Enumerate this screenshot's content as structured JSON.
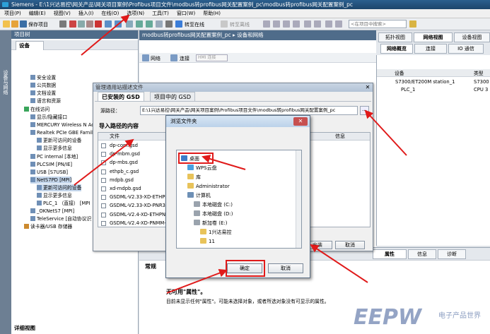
{
  "window": {
    "title": "Siemens - E:\\1兴达易控\\网关产品\\网关项目案例\\Profibus项目文件\\modbus转profibus网关配置案例_pc\\modbus转profibus网关配置案例_pc"
  },
  "menu": [
    "项目(P)",
    "编辑(E)",
    "视图(V)",
    "插入(I)",
    "在线(O)",
    "选项(N)",
    "工具(T)",
    "窗口(W)",
    "帮助(H)"
  ],
  "toolbar": {
    "save_label": "保存项目",
    "online_label": "转至在线",
    "offline_label": "转至离线",
    "search_placeholder": "<在项目中搜索>"
  },
  "side_strip": {
    "label": "设备与网络"
  },
  "project_tree": {
    "title": "项目树",
    "devices_tab": "设备",
    "items": [
      {
        "label": "安全设置",
        "indent": 1
      },
      {
        "label": "公共数据",
        "indent": 1
      },
      {
        "label": "文档设置",
        "indent": 1
      },
      {
        "label": "语言和资源",
        "indent": 1
      },
      {
        "label": "在线访问",
        "indent": 0
      },
      {
        "label": "显示/隐藏接口",
        "indent": 1
      },
      {
        "label": "MERCURY Wireless N Ad",
        "indent": 1
      },
      {
        "label": "Realtek PCIe GBE Family",
        "indent": 1
      },
      {
        "label": "更新可访问的设备",
        "indent": 2
      },
      {
        "label": "显示更多信息",
        "indent": 2
      },
      {
        "label": "PC internal [本地]",
        "indent": 1
      },
      {
        "label": "PLCSIM [PN/IE]",
        "indent": 1
      },
      {
        "label": "USB [S7USB]",
        "indent": 1
      },
      {
        "label": "NetS7PD [MPI]",
        "indent": 1
      },
      {
        "label": "更新可访问的设备",
        "indent": 2
      },
      {
        "label": "显示更多信息",
        "indent": 2
      },
      {
        "label": "PLC_1 （直接） [MPI",
        "indent": 2
      },
      {
        "label": "_OKNetS7 [MPI]",
        "indent": 1
      },
      {
        "label": "TeleService [自动协议识",
        "indent": 1
      },
      {
        "label": "读卡器/USB 存储器",
        "indent": 0
      }
    ],
    "detail_view": "详细视图"
  },
  "editor": {
    "title": "modbus转profibus网关配置案例_pc  ▸  设备和网络",
    "view_tabs": [
      "拓扑视图",
      "网络视图",
      "设备视图"
    ],
    "network_label": "网络",
    "connect_label": "连接",
    "hmi_select": "HMI 连接"
  },
  "right_panel": {
    "tabs": [
      "网络概览",
      "连接",
      "IO 通信"
    ],
    "col_device": "设备",
    "col_type": "类型",
    "rows": [
      {
        "name": "S7300/ET200M station_1",
        "type": "S7300"
      },
      {
        "name": "PLC_1",
        "type": "CPU 3"
      }
    ]
  },
  "gsd_dialog": {
    "title": "管理通用站描述文件",
    "tabs": [
      "已安装的 GSD",
      "项目中的 GSD"
    ],
    "source_path_label": "源路径：",
    "source_path": "E:\\1兴达易控\\网关产品\\网关项目案例\\Profibus项目文件\\modbus转profibus网关配置案例_pc",
    "import_header": "导入路径的内容",
    "col_file": "文件",
    "col_info": "信息",
    "files": [
      "dp-com.gsd",
      "dp-mbm.gsd",
      "dp-mbs.gsd",
      "ethpb_c.gsd",
      "mdpb.gsd",
      "xd-mdpb.gsd",
      "GSDML-V2.33-XD-ETHPN2...",
      "GSDML-V2.33-XD-PNR3-20...",
      "GSDML-V2.4-XD-ETHPN20...",
      "GSDML-V2.4-XD-PNMM-20..."
    ],
    "install_button": "安装",
    "cancel_button": "取消"
  },
  "folder_dialog": {
    "title": "浏览文件夹",
    "items": [
      {
        "label": "桌面",
        "indent": 0,
        "icon": "desktop"
      },
      {
        "label": "WPS云盘",
        "indent": 1,
        "icon": "cloud"
      },
      {
        "label": "库",
        "indent": 1,
        "icon": "folder"
      },
      {
        "label": "Administrator",
        "indent": 1,
        "icon": "user"
      },
      {
        "label": "计算机",
        "indent": 1,
        "icon": "computer"
      },
      {
        "label": "本地磁盘 (C:)",
        "indent": 2,
        "icon": "drive"
      },
      {
        "label": "本地磁盘 (D:)",
        "indent": 2,
        "icon": "drive"
      },
      {
        "label": "新加卷 (E:)",
        "indent": 2,
        "icon": "drive"
      },
      {
        "label": "1兴达易控",
        "indent": 3,
        "icon": "folder"
      },
      {
        "label": "11",
        "indent": 3,
        "icon": "folder"
      }
    ],
    "ok_button": "确定",
    "cancel_button": "取消"
  },
  "properties": {
    "tabs": [
      "属性",
      "信息",
      "诊断"
    ],
    "general_tab": "常规",
    "unavailable_title": "无可用\"属性\"。",
    "unavailable_desc": "目前未显示任何\"属性\"。可能未选择对象，或者所选对象没有可显示的属性。"
  },
  "watermark": {
    "brand": "EEPW",
    "cn": "电子产品世界"
  },
  "colors": {
    "title_bar": "#1f4a72",
    "panel_header": "#4f6c8a",
    "highlight_red": "#e01a1a",
    "selection": "#c5d7ec"
  }
}
